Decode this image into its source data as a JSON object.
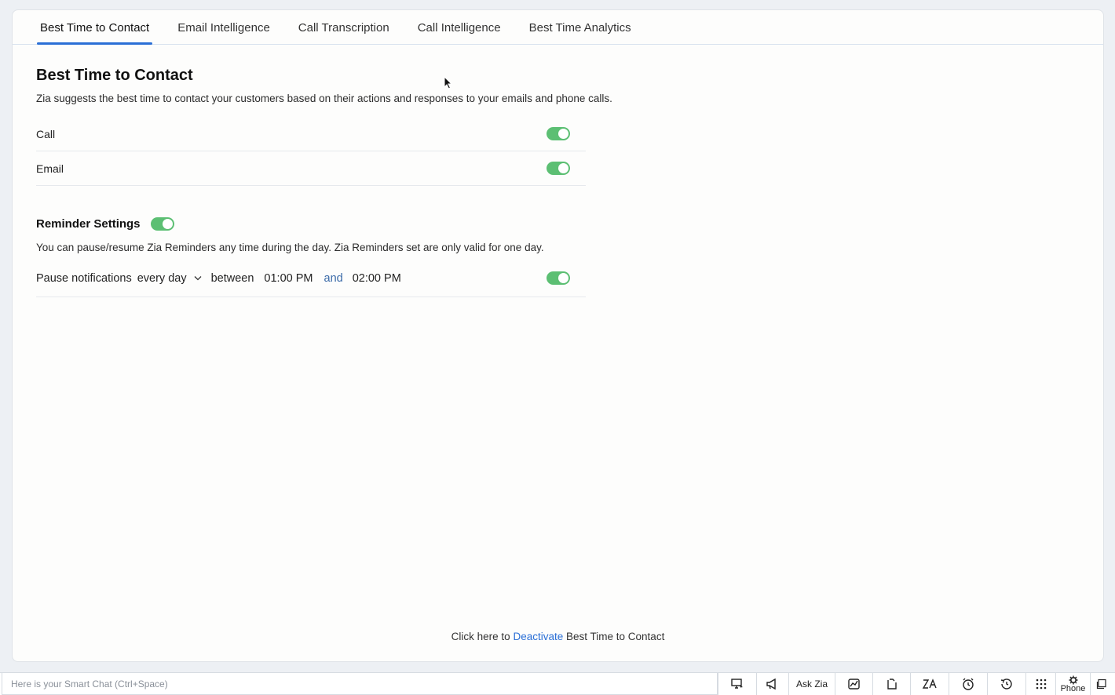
{
  "tabs": [
    {
      "label": "Best Time to Contact",
      "active": true
    },
    {
      "label": "Email Intelligence",
      "active": false
    },
    {
      "label": "Call Transcription",
      "active": false
    },
    {
      "label": "Call Intelligence",
      "active": false
    },
    {
      "label": "Best Time Analytics",
      "active": false
    }
  ],
  "main": {
    "title": "Best Time to Contact",
    "description": "Zia suggests the best time to contact your customers based on their actions and responses to your emails and phone calls.",
    "channels": [
      {
        "label": "Call",
        "enabled": true
      },
      {
        "label": "Email",
        "enabled": true
      }
    ]
  },
  "reminder": {
    "title": "Reminder Settings",
    "enabled": true,
    "description": "You can pause/resume Zia Reminders any time during the day. Zia Reminders set are only valid for one day.",
    "pause_label": "Pause notifications",
    "frequency": "every day",
    "between_label": "between",
    "start_time": "01:00 PM",
    "and_label": "and",
    "end_time": "02:00 PM",
    "pause_enabled": true
  },
  "footer": {
    "prefix": "Click here to",
    "link": "Deactivate",
    "suffix": "Best Time to Contact"
  },
  "bottombar": {
    "smartchat_placeholder": "Here is your Smart Chat (Ctrl+Space)",
    "ask_zia": "Ask Zia",
    "phone": "Phone",
    "icons": [
      "screen-share-icon",
      "megaphone-icon",
      "ask-zia",
      "chart-icon",
      "clipboard-icon",
      "zia-icon",
      "alarm-icon",
      "history-icon",
      "apps-grid-icon",
      "phone-gear-icon",
      "notes-icon"
    ]
  },
  "colors": {
    "accent": "#2a6fd6",
    "toggle_on": "#5cbf73",
    "background": "#edf0f4"
  }
}
